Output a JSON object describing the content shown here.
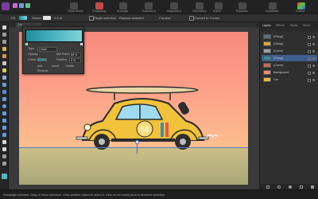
{
  "toolbar": {
    "personas": [
      "Designer",
      "Pixel",
      "Export"
    ],
    "groups": [
      {
        "label": "View Mode"
      },
      {
        "label": "Snapping"
      },
      {
        "label": "Arrange"
      },
      {
        "label": "Transform"
      },
      {
        "label": "Alignment"
      },
      {
        "label": "Geometry"
      },
      {
        "label": "Insert"
      }
    ],
    "right_buttons": [
      "Boolean",
      "Assistant",
      "Colour"
    ]
  },
  "context_bar": {
    "fill_label": "Fill:",
    "stroke_label": "Stroke:",
    "width_value": "0.5 pt",
    "options": [
      "Single selection",
      "Replace selected",
      "Corners:",
      "Convert to Curves"
    ]
  },
  "document_tab": {
    "title": "Car Illustration.afdesign"
  },
  "gradient_dialog": {
    "tabs": [
      "Colour",
      "Gradient"
    ],
    "active_tab": "Gradient",
    "type_label": "Type:",
    "type_value": "Linear",
    "opacity_label": "Opacity:",
    "opacity_value": "100 %",
    "colour_label": "Colour:",
    "mid_label": "Mid Point:",
    "mid_value": "50 %",
    "position_label": "Position:",
    "position_value": "0 %",
    "buttons": [
      "Add",
      "Insert",
      "Delete"
    ],
    "reverse_label": "Reverse",
    "colours": {
      "start": "#1f8e9e",
      "mid": "#4fb6c3",
      "end": "#7fd4d8"
    }
  },
  "layers_panel": {
    "tabs": [
      "Layers",
      "Effects",
      "Styles",
      "Stock"
    ],
    "active_tab": "Layers",
    "layers": [
      {
        "name": "(Group)",
        "thumb_color": "#5a6e7a",
        "selected": false
      },
      {
        "name": "(Group)",
        "thumb_color": "#d9a83a",
        "selected": false
      },
      {
        "name": "(Curve)",
        "thumb_color": "#9aa0a6",
        "selected": false
      },
      {
        "name": "(Group)",
        "thumb_color": "#3a8aa0",
        "selected": true
      },
      {
        "name": "(Curve)",
        "thumb_color": "#c76c5c",
        "selected": false
      },
      {
        "name": "Background",
        "thumb_color": "#e98a78",
        "selected": false
      },
      {
        "name": "Car",
        "thumb_color": "#e8b845",
        "selected": false
      }
    ]
  },
  "artwork": {
    "sky_top": "#f6897c",
    "sky_bottom": "#fcbf8f",
    "ground_top": "#cbbf86",
    "car_body": "#f2c23a",
    "car_number": "56"
  },
  "status_bar": {
    "hint": "Rectangle  selected. Drag to move selection. Click another object to select it. Click on an empty area to deselect selection."
  }
}
